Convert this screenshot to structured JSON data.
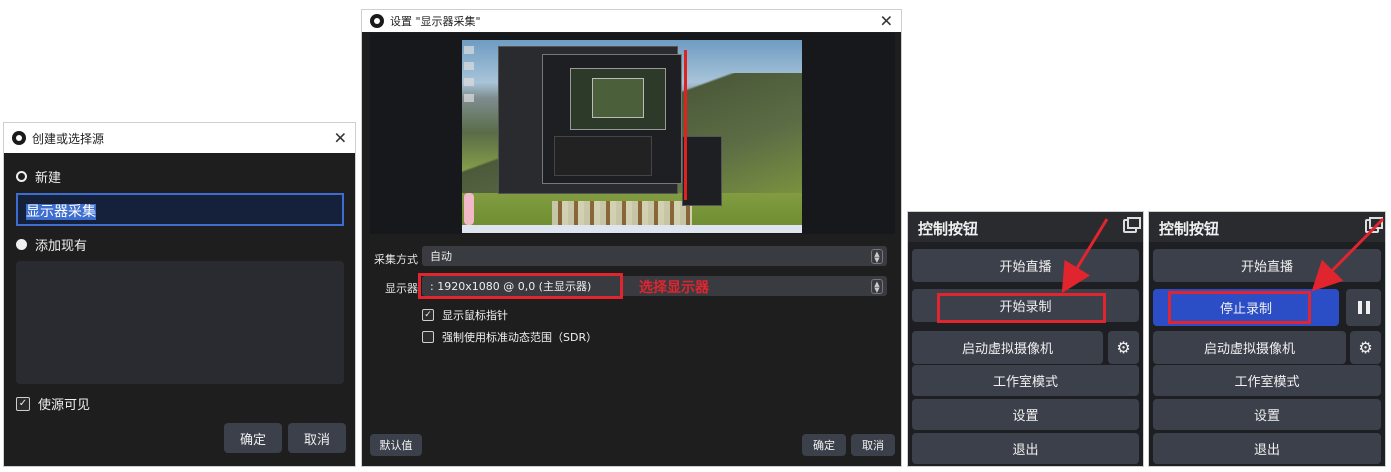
{
  "dialog_create": {
    "title": "创建或选择源",
    "new_label": "新建",
    "new_name_value": "显示器采集",
    "add_existing_label": "添加现有",
    "visible_label": "使源可见",
    "ok_label": "确定",
    "cancel_label": "取消"
  },
  "dialog_settings": {
    "title": "设置 \"显示器采集\"",
    "capture_method_label": "采集方式",
    "capture_method_value": "自动",
    "display_label": "显示器",
    "display_value": ": 1920x1080 @ 0,0 (主显示器)",
    "annotation": "选择显示器",
    "show_cursor_label": "显示鼠标指针",
    "force_sdr_label": "强制使用标准动态范围（SDR）",
    "defaults_label": "默认值",
    "ok_label": "确定",
    "cancel_label": "取消"
  },
  "panel_left": {
    "title": "控制按钮",
    "buttons": [
      "开始直播",
      "开始录制",
      "启动虚拟摄像机",
      "工作室模式",
      "设置",
      "退出"
    ]
  },
  "panel_right": {
    "title": "控制按钮",
    "buttons": [
      "开始直播",
      "停止录制",
      "启动虚拟摄像机",
      "工作室模式",
      "设置",
      "退出"
    ]
  },
  "colors": {
    "dark_bg": "#1e1e1e",
    "button_bg": "#3c404b",
    "accent_blue": "#2b4ec6",
    "annotation_red": "#e0252e"
  },
  "icons": {
    "app_logo": "obs-logo-icon",
    "close": "close-icon",
    "gear": "gear-icon",
    "pause": "pause-icon",
    "undock": "undock-icon"
  }
}
